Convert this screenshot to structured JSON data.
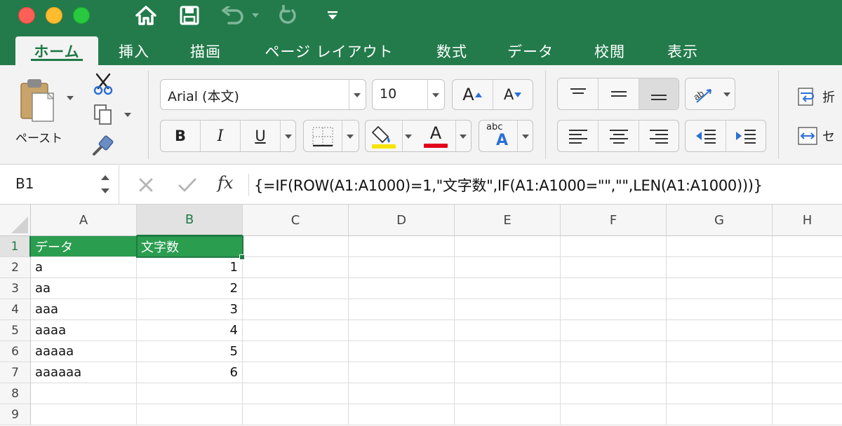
{
  "quick_access": {
    "home_icon": "home-icon",
    "save_icon": "save-icon",
    "undo_icon": "undo-icon",
    "redo_icon": "redo-icon",
    "customize_icon": "chevron-down-icon"
  },
  "tabs": [
    {
      "label": "ホーム",
      "active": true
    },
    {
      "label": "挿入"
    },
    {
      "label": "描画"
    },
    {
      "label": "ページ レイアウト"
    },
    {
      "label": "数式"
    },
    {
      "label": "データ"
    },
    {
      "label": "校閲"
    },
    {
      "label": "表示"
    }
  ],
  "ribbon": {
    "paste_label": "ペースト",
    "font_name": "Arial (本文)",
    "font_size": "10",
    "bold": "B",
    "italic": "I",
    "underline": "U",
    "grow_font": "A",
    "shrink_font": "A",
    "font_color_letter": "A",
    "phonetic_top": "abc",
    "phonetic_bottom": "A",
    "wrap_label": "折",
    "merge_label": "セ",
    "fill_color": "#f6e400",
    "font_color": "#e3001b"
  },
  "formula_bar": {
    "name_box": "B1",
    "cancel_icon": "close-icon",
    "enter_icon": "check-icon",
    "fx_label": "fx",
    "formula": "{=IF(ROW(A1:A1000)=1,\"文字数\",IF(A1:A1000=\"\",\"\",LEN(A1:A1000)))}"
  },
  "sheet": {
    "columns": [
      "A",
      "B",
      "C",
      "D",
      "E",
      "F",
      "G",
      "H"
    ],
    "rows": [
      "1",
      "2",
      "3",
      "4",
      "5",
      "6",
      "7",
      "8",
      "9"
    ],
    "selected_cell": "B1",
    "header_fill": "#2a9d4f",
    "data": [
      {
        "a": "データ",
        "b": "文字数"
      },
      {
        "a": "a",
        "b": "1"
      },
      {
        "a": "aa",
        "b": "2"
      },
      {
        "a": "aaa",
        "b": "3"
      },
      {
        "a": "aaaa",
        "b": "4"
      },
      {
        "a": "aaaaa",
        "b": "5"
      },
      {
        "a": "aaaaaa",
        "b": "6"
      },
      {
        "a": "",
        "b": ""
      },
      {
        "a": "",
        "b": ""
      }
    ]
  }
}
